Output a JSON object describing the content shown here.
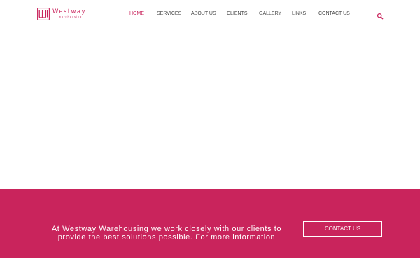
{
  "brand": {
    "name": "Westway",
    "subtitle": "warehousing",
    "accent_color": "#c9245c",
    "logo_icon": "westway-w-logo-icon"
  },
  "nav": {
    "items": [
      {
        "label": "HOME",
        "active": true
      },
      {
        "label": "SERVICES",
        "active": false
      },
      {
        "label": "ABOUT US",
        "active": false
      },
      {
        "label": "CLIENTS",
        "active": false
      },
      {
        "label": "GALLERY",
        "active": false
      },
      {
        "label": "LINKS",
        "active": false
      },
      {
        "label": "CONTACT US",
        "active": false
      }
    ],
    "search_icon": "search-icon"
  },
  "cta": {
    "text": "At Westway Warehousing we work closely with our clients to provide the best solutions possible. For more information",
    "button_label": "CONTACT US",
    "background_color": "#c9245c"
  }
}
